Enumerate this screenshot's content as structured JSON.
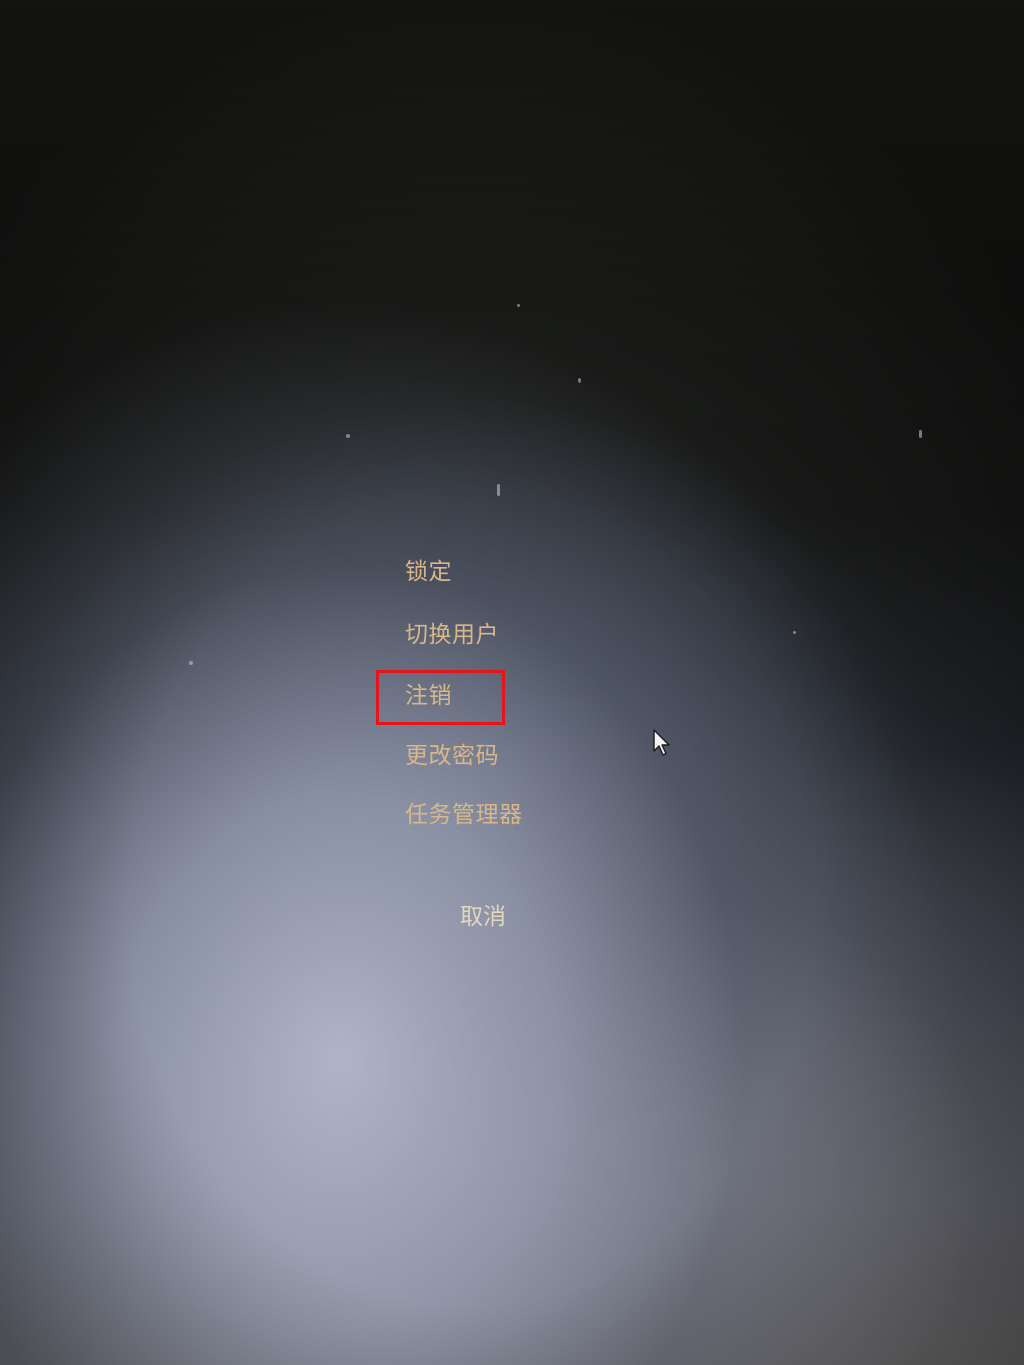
{
  "security_menu": {
    "items": [
      {
        "label": "锁定"
      },
      {
        "label": "切换用户"
      },
      {
        "label": "注销"
      },
      {
        "label": "更改密码"
      },
      {
        "label": "任务管理器"
      }
    ],
    "cancel_label": "取消",
    "highlighted_item": "注销"
  },
  "colors": {
    "menu_text": "#d9b78a",
    "cancel_text": "#e4d6c0",
    "highlight_border": "#e8141c"
  },
  "icons": {
    "cursor": "mouse-pointer-icon"
  }
}
